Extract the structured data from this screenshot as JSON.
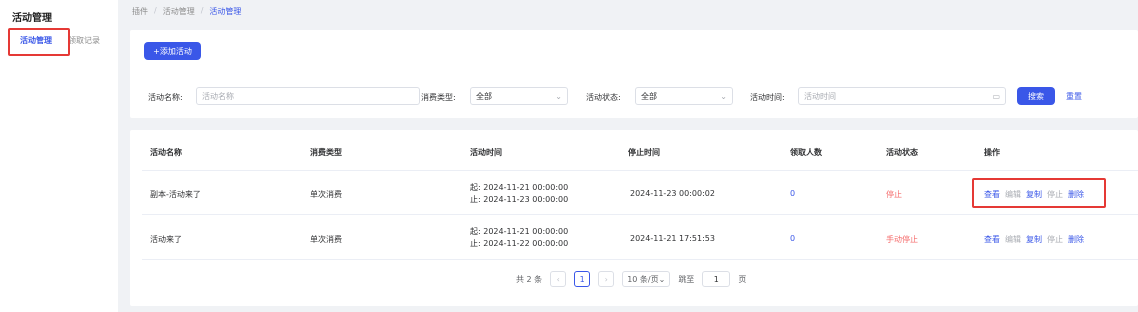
{
  "sidebar": {
    "title": "活动管理",
    "items": [
      {
        "label": "活动管理",
        "active": true
      },
      {
        "label": "领取记录",
        "active": false
      }
    ]
  },
  "breadcrumb": [
    "插件",
    "活动管理",
    "活动管理"
  ],
  "toolbar": {
    "add_label": "+添加活动"
  },
  "filters": {
    "name_label": "活动名称:",
    "name_placeholder": "活动名称",
    "type_label": "消费类型:",
    "type_value": "全部",
    "status_label": "活动状态:",
    "status_value": "全部",
    "time_label": "活动时间:",
    "time_placeholder": "活动时间",
    "search_label": "搜索",
    "reset_label": "重置"
  },
  "table": {
    "headers": [
      "活动名称",
      "消费类型",
      "活动时间",
      "停止时间",
      "领取人数",
      "活动状态",
      "操作"
    ],
    "rows": [
      {
        "name": "副本-活动来了",
        "type": "单次消费",
        "start": "起: 2024-11-21 00:00:00",
        "end": "止: 2024-11-23 00:00:00",
        "stop_time": "2024-11-23 00:00:02",
        "count": "0",
        "status": "停止",
        "ops": [
          "查看",
          "编辑",
          "复制",
          "停止",
          "删除"
        ]
      },
      {
        "name": "活动来了",
        "type": "单次消费",
        "start": "起: 2024-11-21 00:00:00",
        "end": "止: 2024-11-22 00:00:00",
        "stop_time": "2024-11-21 17:51:53",
        "count": "0",
        "status": "手动停止",
        "ops": [
          "查看",
          "编辑",
          "复制",
          "停止",
          "删除"
        ]
      }
    ]
  },
  "pagination": {
    "total": "共 2 条",
    "current_page": "1",
    "page_size": "10 条/页",
    "jump_label": "跳至",
    "jump_value": "1",
    "page_suffix": "页"
  },
  "colors": {
    "accent": "#3a57e8",
    "danger": "#f56c6c",
    "highlight_box": "#e53935"
  }
}
